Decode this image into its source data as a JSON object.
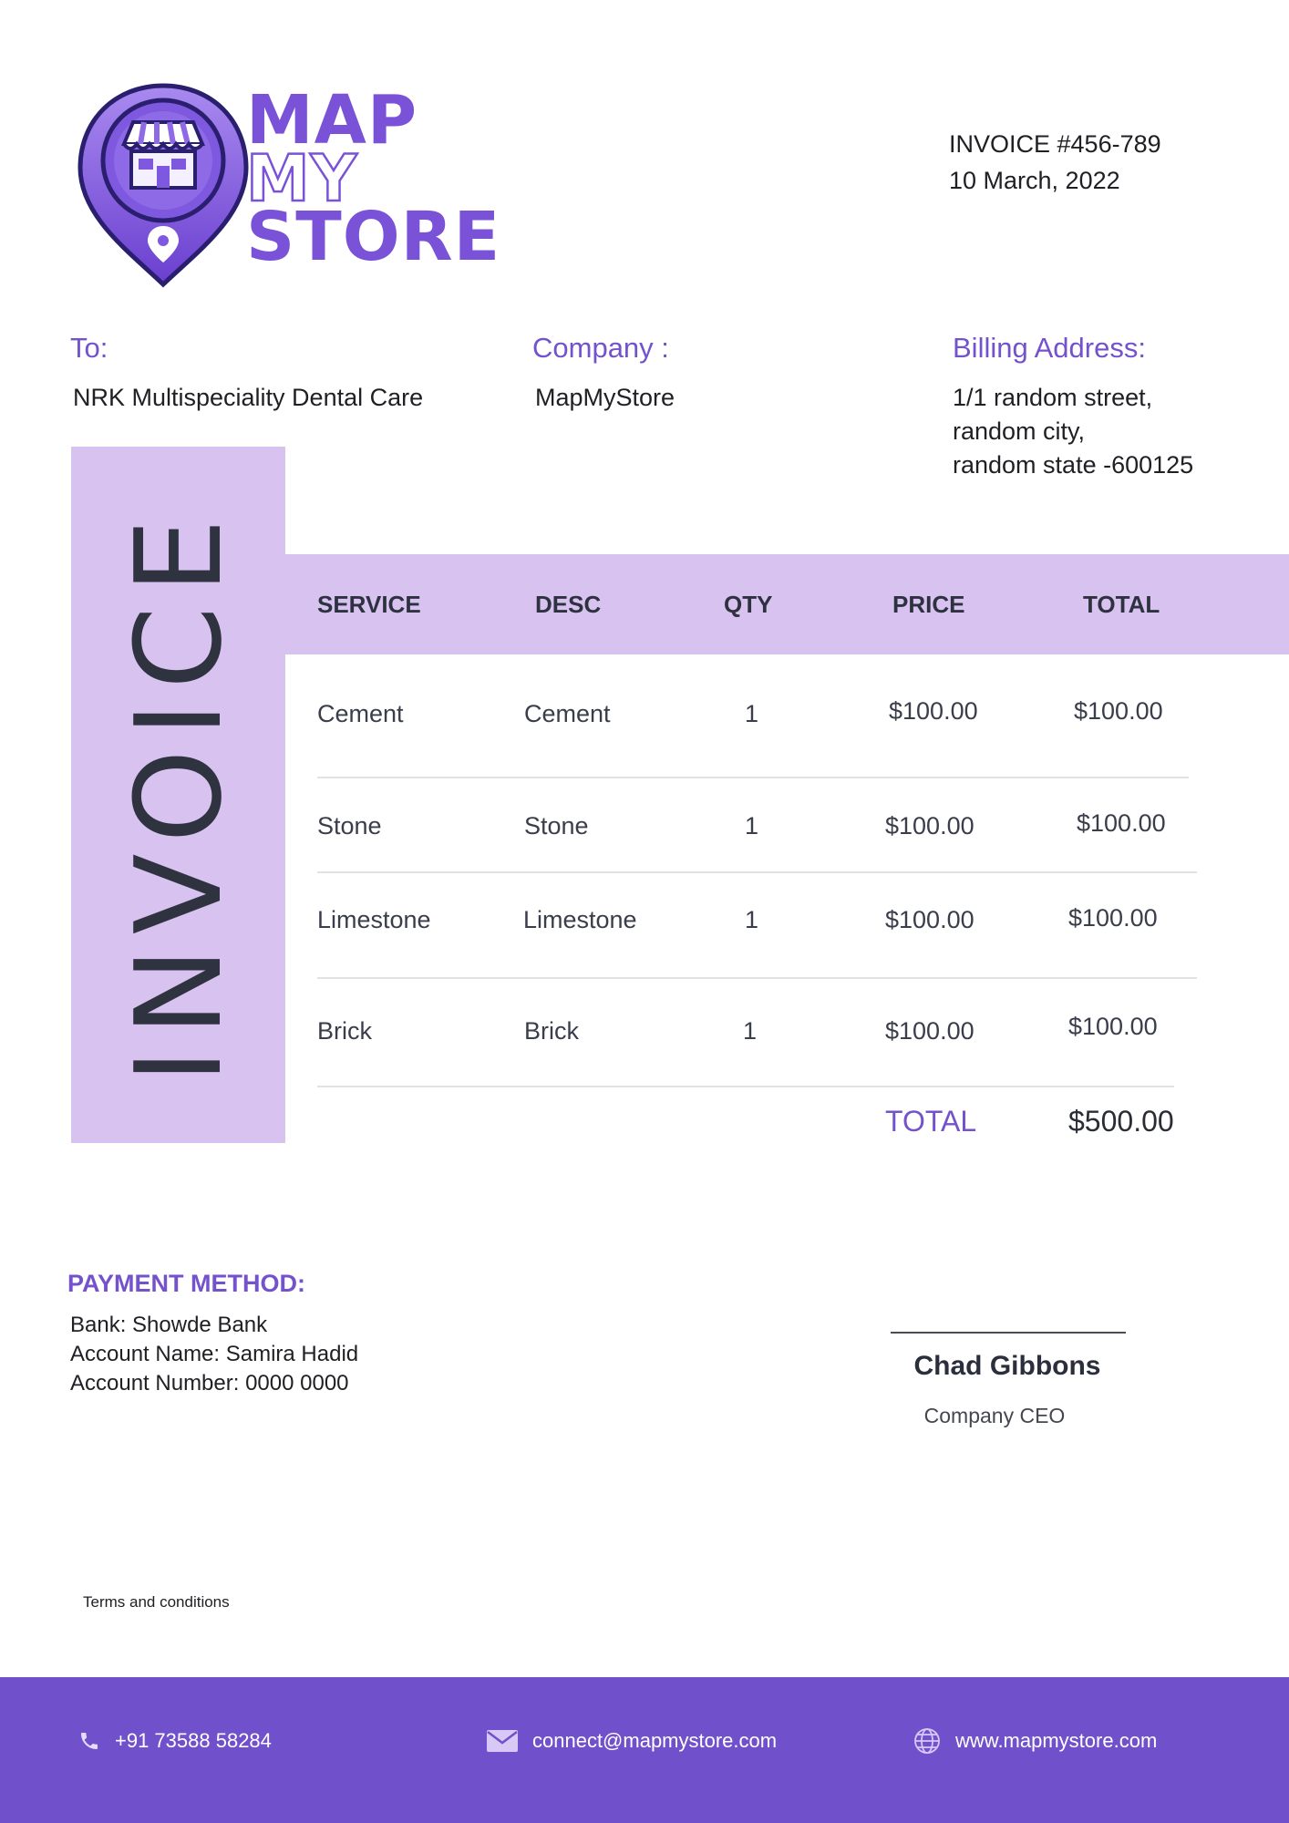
{
  "logo": {
    "line1": "MAP",
    "line2": "MY",
    "line3": "STORE",
    "icon": "store-location-pin-icon",
    "brand_color": "#7a52d8"
  },
  "invoice": {
    "number": "INVOICE #456-789",
    "date": "10 March, 2022",
    "band_word": "INVOICE"
  },
  "parties": {
    "to_label": "To:",
    "to_value": "NRK Multispeciality Dental Care",
    "company_label": "Company :",
    "company_value": "MapMyStore",
    "billing_label": "Billing Address:",
    "billing_lines": [
      "1/1 random street,",
      "random city,",
      "random state -600125"
    ]
  },
  "table": {
    "headers": [
      "SERVICE",
      "DESC",
      "QTY",
      "PRICE",
      "TOTAL"
    ],
    "rows": [
      [
        "Cement",
        "Cement",
        "1",
        "$100.00",
        "$100.00"
      ],
      [
        "Stone",
        "Stone",
        "1",
        "$100.00",
        "$100.00"
      ],
      [
        "Limestone",
        "Limestone",
        "1",
        "$100.00",
        "$100.00"
      ],
      [
        "Brick",
        "Brick",
        "1",
        "$100.00",
        "$100.00"
      ]
    ],
    "total_label": "TOTAL",
    "total_value": "$500.00"
  },
  "payment": {
    "title": "PAYMENT METHOD:",
    "bank": "Bank: Showde Bank",
    "account_name": "Account Name: Samira Hadid",
    "account_number": "Account Number: 0000 0000"
  },
  "signature": {
    "name": "Chad Gibbons",
    "role": "Company CEO"
  },
  "terms": "Terms and conditions",
  "footer": {
    "phone": "+91 73588 58284",
    "email": "connect@mapmystore.com",
    "website": "www.mapmystore.com",
    "phone_icon": "phone-icon",
    "email_icon": "envelope-icon",
    "website_icon": "globe-icon"
  },
  "colors": {
    "accent": "#7452cc",
    "band": "#d8c2f0",
    "footer": "#7050cb"
  }
}
